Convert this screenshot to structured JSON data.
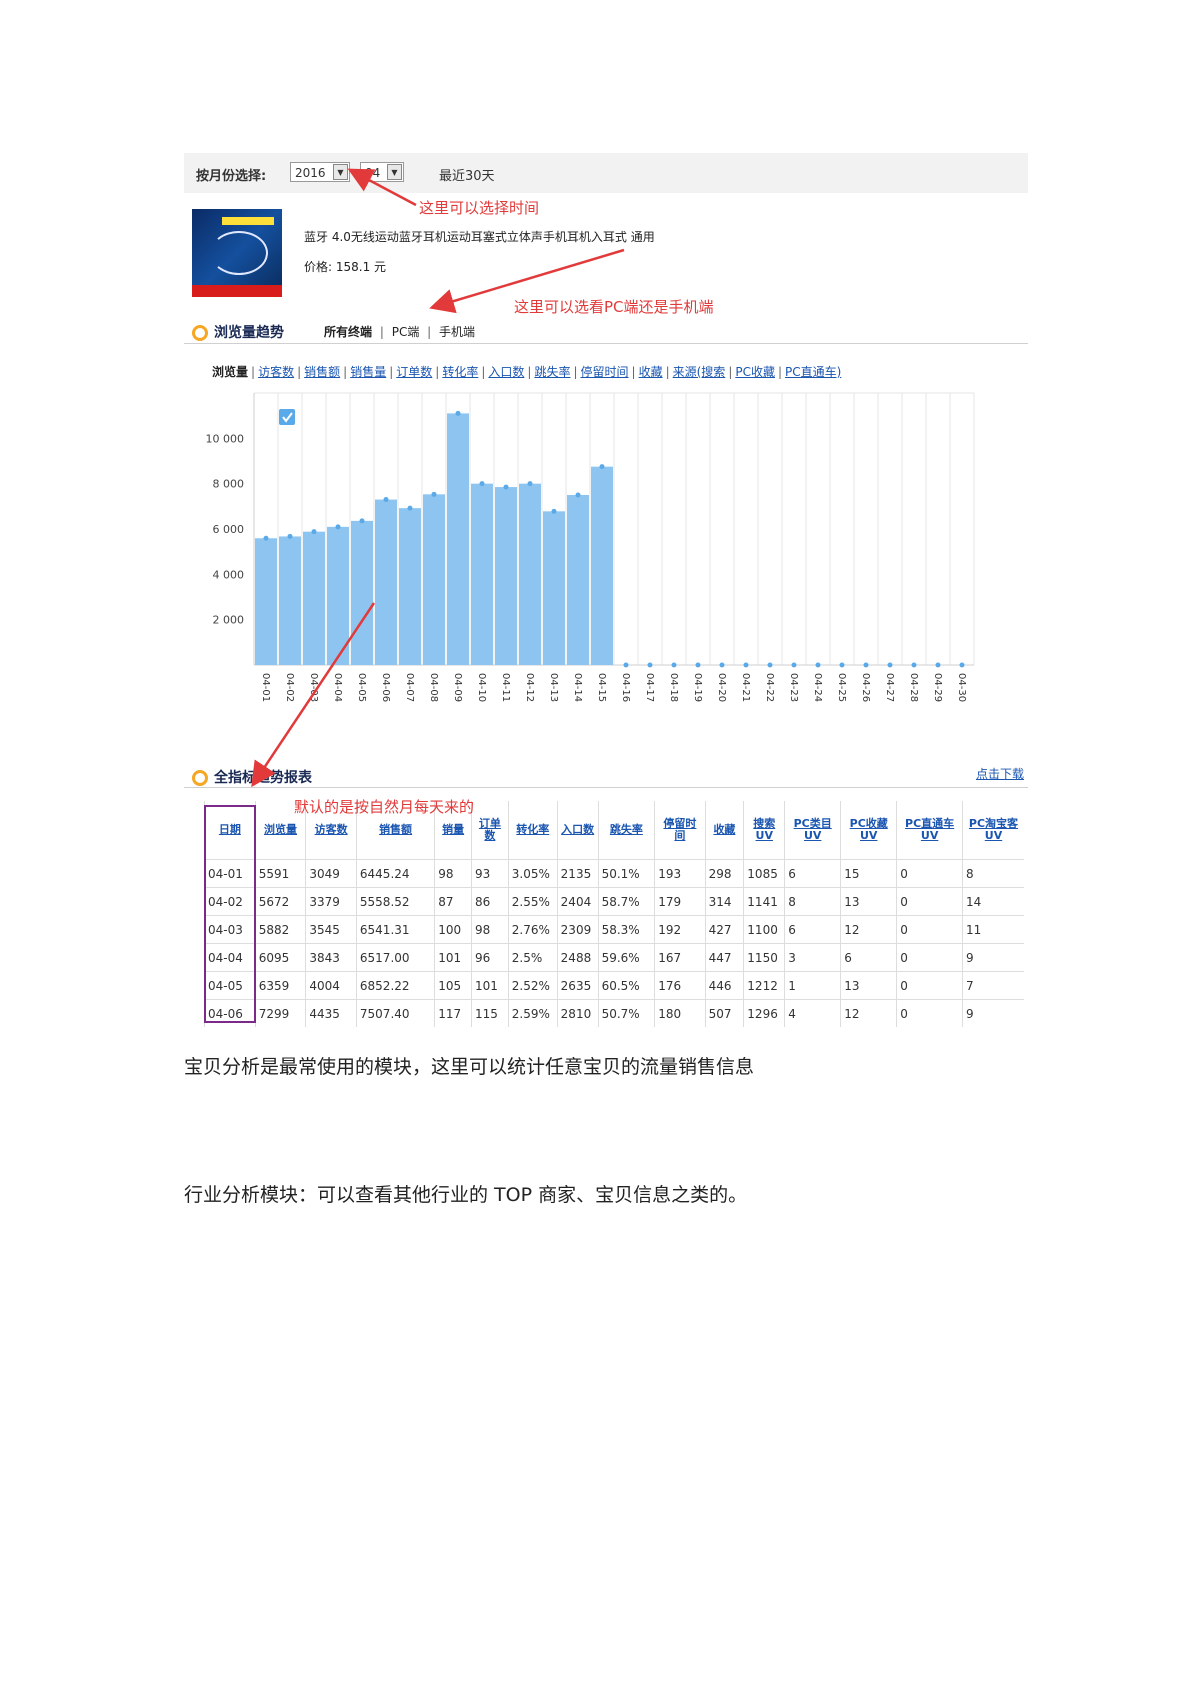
{
  "filter": {
    "label": "按月份选择:",
    "year": "2016",
    "month": "04",
    "recent": "最近30天"
  },
  "product": {
    "name": "蓝牙 4.0无线运动蓝牙耳机运动耳塞式立体声手机耳机入耳式 通用",
    "price": "价格: 158.1 元"
  },
  "trend": {
    "title": "浏览量趋势",
    "tabs": [
      "所有终端",
      "PC端",
      "手机端"
    ]
  },
  "metrics": [
    "浏览量",
    "访客数",
    "销售额",
    "销售量",
    "订单数",
    "转化率",
    "入口数",
    "跳失率",
    "停留时间",
    "收藏",
    "来源(搜索",
    "PC收藏",
    "PC直通车)"
  ],
  "annotations": {
    "time": "这里可以选择时间",
    "device": "这里可以选看PC端还是手机端",
    "daily": "默认的是按自然月每天来的"
  },
  "chart_data": {
    "type": "bar",
    "categories": [
      "04-01",
      "04-02",
      "04-03",
      "04-04",
      "04-05",
      "04-06",
      "04-07",
      "04-08",
      "04-09",
      "04-10",
      "04-11",
      "04-12",
      "04-13",
      "04-14",
      "04-15",
      "04-16",
      "04-17",
      "04-18",
      "04-19",
      "04-20",
      "04-21",
      "04-22",
      "04-23",
      "04-24",
      "04-25",
      "04-26",
      "04-27",
      "04-28",
      "04-29",
      "04-30"
    ],
    "values": [
      5591,
      5672,
      5882,
      6095,
      6359,
      7299,
      6920,
      7530,
      11100,
      8000,
      7850,
      8000,
      6780,
      7500,
      8750,
      0,
      0,
      0,
      0,
      0,
      0,
      0,
      0,
      0,
      0,
      0,
      0,
      0,
      0,
      0
    ],
    "yticks": [
      "2 000",
      "4 000",
      "6 000",
      "8 000",
      "10 000"
    ],
    "ylim": [
      0,
      12000
    ],
    "color": "#8ec5f0",
    "grid": true
  },
  "report": {
    "title": "全指标趋势报表",
    "download": "点击下载",
    "headers": [
      "日期",
      "浏览量",
      "访客数",
      "销售额",
      "销量",
      "订单数",
      "转化率",
      "入口数",
      "跳失率",
      "停留时间",
      "收藏",
      "搜索UV",
      "PC类目UV",
      "PC收藏UV",
      "PC直通车UV",
      "PC淘宝客UV"
    ],
    "rows": [
      [
        "04-01",
        "5591",
        "3049",
        "6445.24",
        "98",
        "93",
        "3.05%",
        "2135",
        "50.1%",
        "193",
        "298",
        "1085",
        "6",
        "15",
        "0",
        "8"
      ],
      [
        "04-02",
        "5672",
        "3379",
        "5558.52",
        "87",
        "86",
        "2.55%",
        "2404",
        "58.7%",
        "179",
        "314",
        "1141",
        "8",
        "13",
        "0",
        "14"
      ],
      [
        "04-03",
        "5882",
        "3545",
        "6541.31",
        "100",
        "98",
        "2.76%",
        "2309",
        "58.3%",
        "192",
        "427",
        "1100",
        "6",
        "12",
        "0",
        "11"
      ],
      [
        "04-04",
        "6095",
        "3843",
        "6517.00",
        "101",
        "96",
        "2.5%",
        "2488",
        "59.6%",
        "167",
        "447",
        "1150",
        "3",
        "6",
        "0",
        "9"
      ],
      [
        "04-05",
        "6359",
        "4004",
        "6852.22",
        "105",
        "101",
        "2.52%",
        "2635",
        "60.5%",
        "176",
        "446",
        "1212",
        "1",
        "13",
        "0",
        "7"
      ],
      [
        "04-06",
        "7299",
        "4435",
        "7507.40",
        "117",
        "115",
        "2.59%",
        "2810",
        "50.7%",
        "180",
        "507",
        "1296",
        "4",
        "12",
        "0",
        "9"
      ]
    ]
  },
  "body": {
    "p1": "宝贝分析是最常使用的模块，这里可以统计任意宝贝的流量销售信息",
    "p2": "行业分析模块：可以查看其他行业的 TOP 商家、宝贝信息之类的。"
  }
}
